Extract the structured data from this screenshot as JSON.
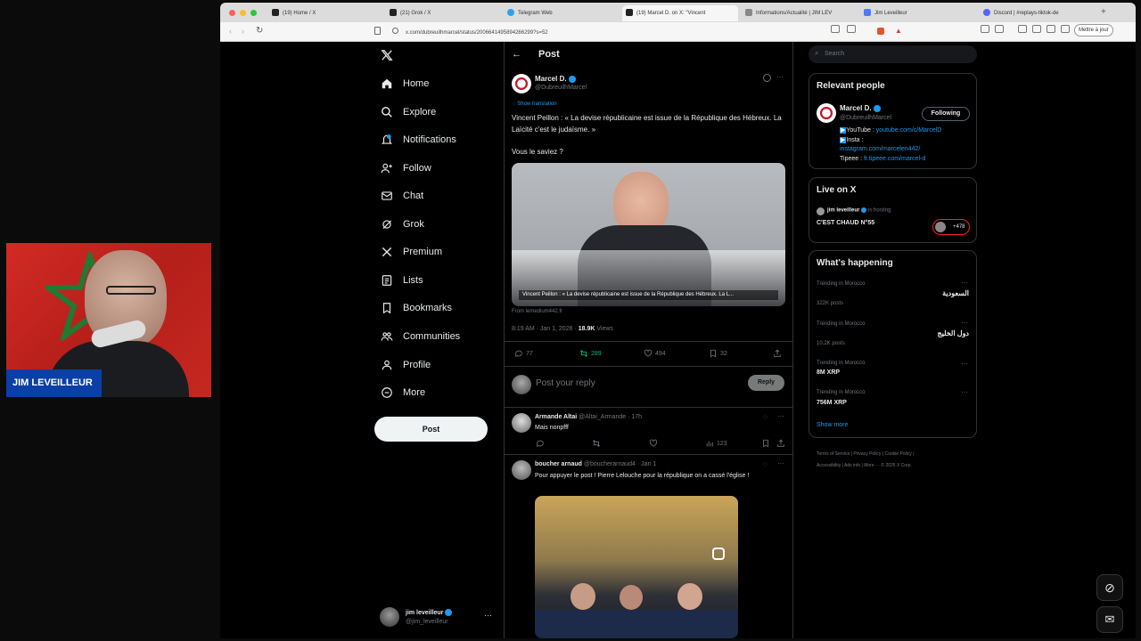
{
  "browser": {
    "tabs": [
      {
        "label": "(19) Home / X"
      },
      {
        "label": "(21) Grok / X"
      },
      {
        "label": "Telegram Web"
      },
      {
        "label": "(19) Marcel D. on X: \"Vincent"
      },
      {
        "label": "Informations/Actualité | JIM LEV"
      },
      {
        "label": "Jim Leveilleur"
      },
      {
        "label": "Discord | #replays-tiktok-de"
      }
    ],
    "url": "x.com/dubreuilhmarcel/status/2006641495894266299?s=52",
    "update_label": "Mettre à jour"
  },
  "webcam": {
    "name": "JIM LEVEILLEUR"
  },
  "sidebar": {
    "items": [
      {
        "label": "Home",
        "icon": "home-icon"
      },
      {
        "label": "Explore",
        "icon": "search-icon"
      },
      {
        "label": "Notifications",
        "icon": "bell-icon"
      },
      {
        "label": "Follow",
        "icon": "add-user-icon"
      },
      {
        "label": "Chat",
        "icon": "mail-icon"
      },
      {
        "label": "Grok",
        "icon": "grok-icon"
      },
      {
        "label": "Premium",
        "icon": "x-logo-icon"
      },
      {
        "label": "Lists",
        "icon": "list-icon"
      },
      {
        "label": "Bookmarks",
        "icon": "bookmark-icon"
      },
      {
        "label": "Communities",
        "icon": "people-icon"
      },
      {
        "label": "Profile",
        "icon": "user-icon"
      },
      {
        "label": "More",
        "icon": "more-circle-icon"
      }
    ],
    "post_label": "Post",
    "account": {
      "name": "jim leveilleur",
      "handle": "@jim_leveilleur"
    }
  },
  "post": {
    "header": "Post",
    "author": {
      "name": "Marcel D.",
      "handle": "@DubreuilhMarcel"
    },
    "show_translation": "Show translation",
    "text": "Vincent Peillon : « La devise républicaine est issue de la République des Hébreux. La Laïcité c'est le judaïsme. »",
    "text2": "Vous le saviez ?",
    "video_caption": "Vincent Peillon : « La devise républicaine est issue de la République des Hébreux. La L...",
    "from": "From lemedium442.fr",
    "time": "8:19 AM · Jan 1, 2026 · ",
    "views": "18.9K",
    "views_label": " Views",
    "stats": {
      "replies": "77",
      "reposts": "289",
      "likes": "494",
      "bookmarks": "32"
    },
    "reply_placeholder": "Post your reply",
    "reply_button": "Reply"
  },
  "replies": [
    {
      "name": "Armande Altai",
      "handle": "@Altai_Armande · 17h",
      "text": "Mais nonpfff",
      "views": "123"
    },
    {
      "name": "boucher arnaud",
      "handle": "@boucherarnaud4 · Jan 1",
      "text": "Pour appuyer le post ! Pierre Lelouche pour la république on a cassé l'église !"
    }
  ],
  "right": {
    "search_placeholder": "Search",
    "relevant": {
      "title": "Relevant people",
      "name": "Marcel D.",
      "handle": "@DubreuilhMarcel",
      "follow": "Following",
      "bio1": "YouTube : ",
      "bio1_link": "youtube.com/c/MarcelD",
      "bio2": "Insta :",
      "bio2_link": "instagram.com/marcelen442/",
      "bio3": "Tipeee : ",
      "bio3_link": "fr.tipeee.com/marcel-d"
    },
    "live": {
      "title": "Live on X",
      "host": "jim leveilleur",
      "status": "is hosting",
      "space": "C'EST CHAUD N°55",
      "count": "+478"
    },
    "happening": {
      "title": "What's happening",
      "trends": [
        {
          "context": "Trending in Morocco",
          "name": "السعودية",
          "posts": "322K posts"
        },
        {
          "context": "Trending in Morocco",
          "name": "دول الخليج",
          "posts": "10.2K posts"
        },
        {
          "context": "Trending in Morocco",
          "name": "8M XRP",
          "posts": ""
        },
        {
          "context": "Trending in Morocco",
          "name": "756M XRP",
          "posts": ""
        }
      ],
      "show_more": "Show more"
    },
    "footer": [
      "Terms of Service",
      "Privacy Policy",
      "Cookie Policy",
      "Accessibility",
      "Ads info",
      "More ···",
      "© 2026 X Corp."
    ]
  },
  "colors": {
    "accent": "#1d9bf0",
    "repost_green": "#00ba7c",
    "background": "#000000"
  }
}
